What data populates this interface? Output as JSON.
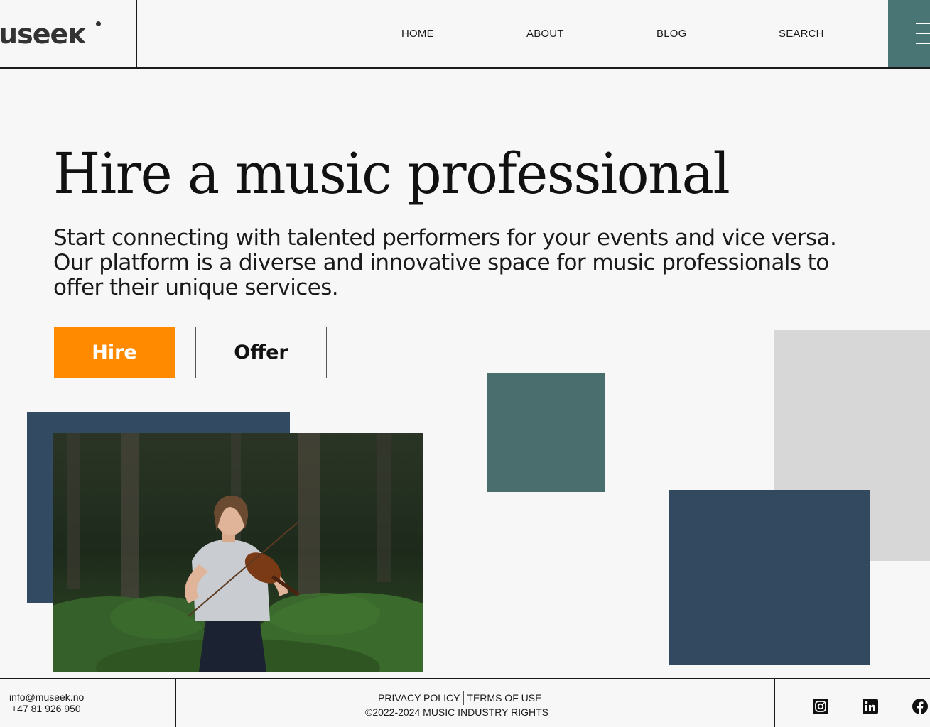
{
  "header": {
    "logo": "luseeĸ",
    "nav": [
      {
        "label": "HOME"
      },
      {
        "label": "ABOUT"
      },
      {
        "label": "BLOG"
      },
      {
        "label": "SEARCH"
      }
    ],
    "menu_icon": "hamburger-menu-icon"
  },
  "hero": {
    "title": "Hire a music professional",
    "subtitle": "Start connecting with talented performers for your events and vice versa. Our platform is a diverse and innovative space for music professionals to offer their unique services.",
    "hire_label": "Hire",
    "offer_label": "Offer"
  },
  "footer": {
    "email": "info@museek.no",
    "phone": "+47 81 926 950",
    "privacy": "PRIVACY POLICY",
    "terms": "TERMS OF USE",
    "copyright": "©2022-2024 MUSIC INDUSTRY RIGHTS",
    "social_icons": [
      "instagram-icon",
      "linkedin-icon",
      "facebook-icon"
    ]
  },
  "colors": {
    "accent_orange": "#ff8a00",
    "teal": "#4a7575",
    "navy": "#324a62",
    "grey": "#d7d7d7",
    "background": "#f7f7f7"
  }
}
